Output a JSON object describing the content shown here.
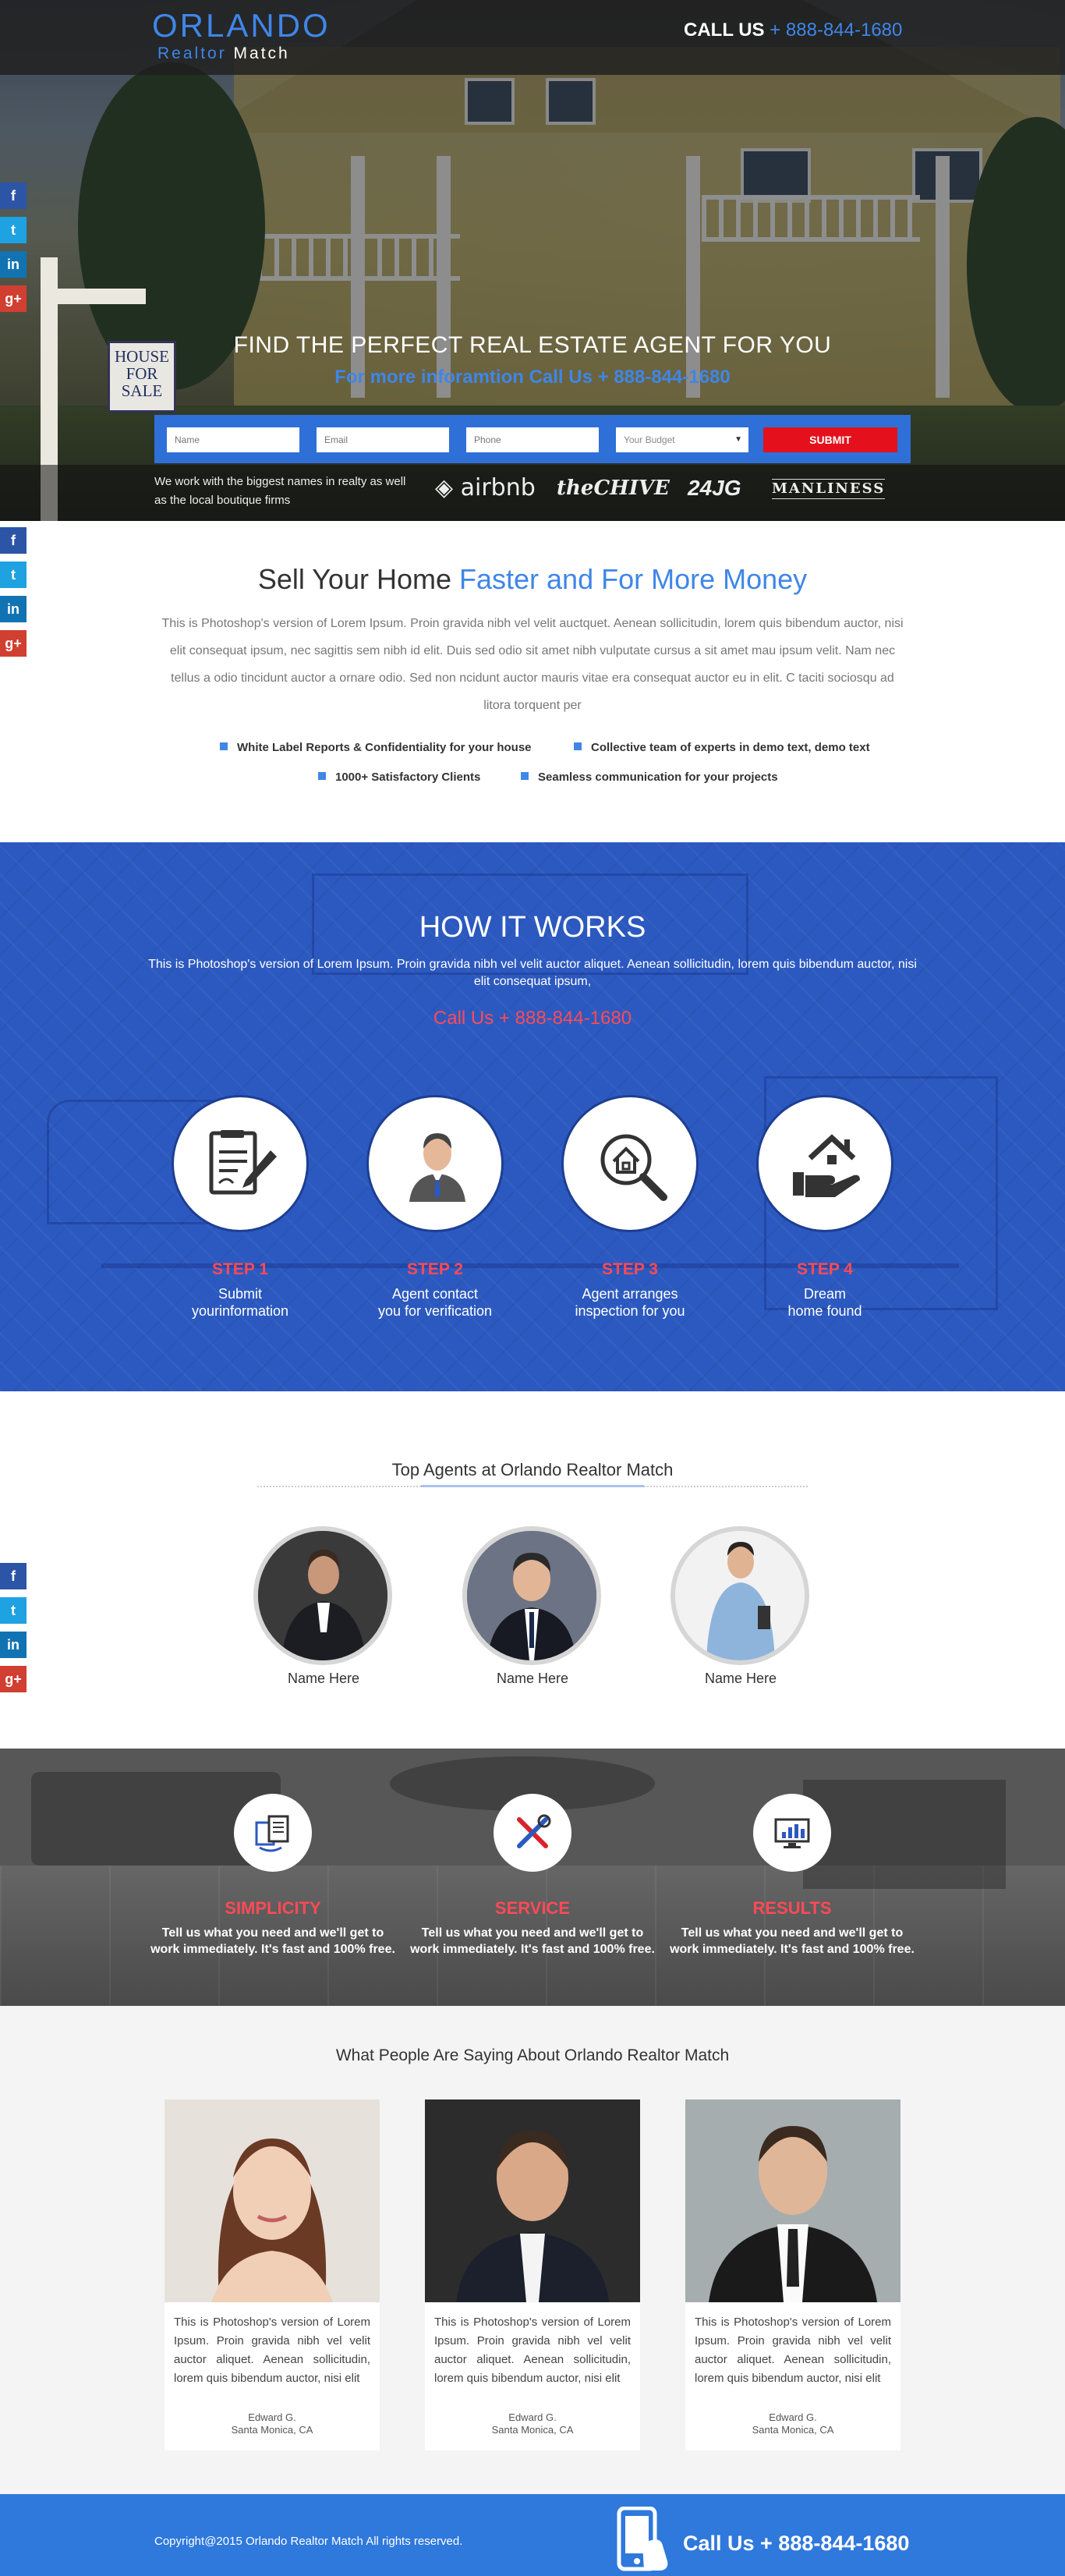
{
  "header": {
    "logo_line1": "ORLANDO",
    "logo_line2_word1": "Realtor",
    "logo_line2_word2": "Match",
    "call_label": "CALL US",
    "call_number": "+ 888-844-1680"
  },
  "hero": {
    "sign_text": "HOUSE FOR SALE",
    "headline": "FIND THE PERFECT REAL ESTATE AGENT FOR YOU",
    "subline": "For more inforamtion Call Us + 888-844-1680",
    "form": {
      "name_placeholder": "Name",
      "email_placeholder": "Email",
      "phone_placeholder": "Phone",
      "budget_selected": "Your Budget",
      "submit_label": "SUBMIT"
    },
    "brands_text": "We work with the biggest names in realty as well as the local boutique firms",
    "brands": [
      "airbnb",
      "theCHIVE",
      "24JG",
      "MANLINESS"
    ]
  },
  "sell": {
    "title_part1": "Sell Your Home",
    "title_part2": "Faster and For More Money",
    "paragraph": "This is Photoshop's version of Lorem Ipsum. Proin gravida nibh vel velit auctquet. Aenean sollicitudin, lorem quis bibendum auctor, nisi elit consequat ipsum, nec sagittis sem nibh id elit. Duis sed odio sit amet nibh vulputate cursus a sit amet mau ipsum velit. Nam nec tellus a odio tincidunt auctor a ornare odio. Sed non ncidunt auctor mauris vitae era consequat auctor eu in elit. C taciti sociosqu ad litora torquent per",
    "features": [
      "White Label Reports & Confidentiality for your house",
      "Collective team of experts in demo text, demo text",
      "1000+ Satisfactory Clients",
      "Seamless communication for your projects"
    ]
  },
  "how": {
    "title": "HOW IT WORKS",
    "paragraph": "This is Photoshop's version of Lorem Ipsum. Proin gravida nibh vel velit auctor aliquet. Aenean sollicitudin, lorem quis bibendum auctor, nisi elit consequat ipsum,",
    "call": "Call Us + 888-844-1680",
    "steps": [
      {
        "label": "STEP 1",
        "line1": "Submit",
        "line2": "yourinformation",
        "icon": "document-pen-icon"
      },
      {
        "label": "STEP 2",
        "line1": "Agent contact",
        "line2": "you for verification",
        "icon": "agent-person-icon"
      },
      {
        "label": "STEP 3",
        "line1": "Agent arranges",
        "line2": "inspection for you",
        "icon": "house-search-icon"
      },
      {
        "label": "STEP 4",
        "line1": "Dream",
        "line2": "home found",
        "icon": "house-hand-icon"
      }
    ]
  },
  "agents": {
    "title": "Top Agents at Orlando Realtor Match",
    "items": [
      {
        "name": "Name Here"
      },
      {
        "name": "Name Here"
      },
      {
        "name": "Name Here"
      }
    ]
  },
  "features": [
    {
      "title": "SIMPLICITY",
      "line1": "Tell us what you need and we'll get to",
      "line2": "work immediately. It's fast and 100% free.",
      "icon": "documents-icon"
    },
    {
      "title": "SERVICE",
      "line1": "Tell us what you need and we'll get to",
      "line2": "work immediately. It's fast and 100% free.",
      "icon": "tools-icon"
    },
    {
      "title": "RESULTS",
      "line1": "Tell us what you need and we'll get to",
      "line2": "work immediately. It's fast and 100% free.",
      "icon": "monitor-chart-icon"
    }
  ],
  "testimonials": {
    "title": "What People Are Saying About Orlando Realtor Match",
    "items": [
      {
        "text": "This is Photoshop's version of Lorem Ipsum. Proin gravida nibh vel velit auctor aliquet. Aenean sollicitudin, lorem quis bibendum auctor, nisi elit",
        "name": "Edward G.",
        "location": "Santa Monica, CA"
      },
      {
        "text": "This is Photoshop's version of Lorem Ipsum. Proin gravida nibh vel velit auctor aliquet. Aenean sollicitudin, lorem quis bibendum auctor, nisi elit",
        "name": "Edward G.",
        "location": "Santa Monica, CA"
      },
      {
        "text": "This is Photoshop's version of Lorem Ipsum. Proin gravida nibh vel velit auctor aliquet. Aenean sollicitudin, lorem quis bibendum auctor, nisi elit",
        "name": "Edward G.",
        "location": "Santa Monica, CA"
      }
    ]
  },
  "social": {
    "facebook": "f",
    "twitter": "t",
    "linkedin": "in",
    "googleplus": "g+"
  },
  "footer": {
    "copyright": "Copyright@2015 Orlando Realtor Match All rights reserved.",
    "call": "Call Us + 888-844-1680"
  },
  "colors": {
    "accent": "#3f86e8",
    "red": "#ff4a55",
    "how_bg": "#2c59c0",
    "footer_bg": "#2f78dc"
  }
}
